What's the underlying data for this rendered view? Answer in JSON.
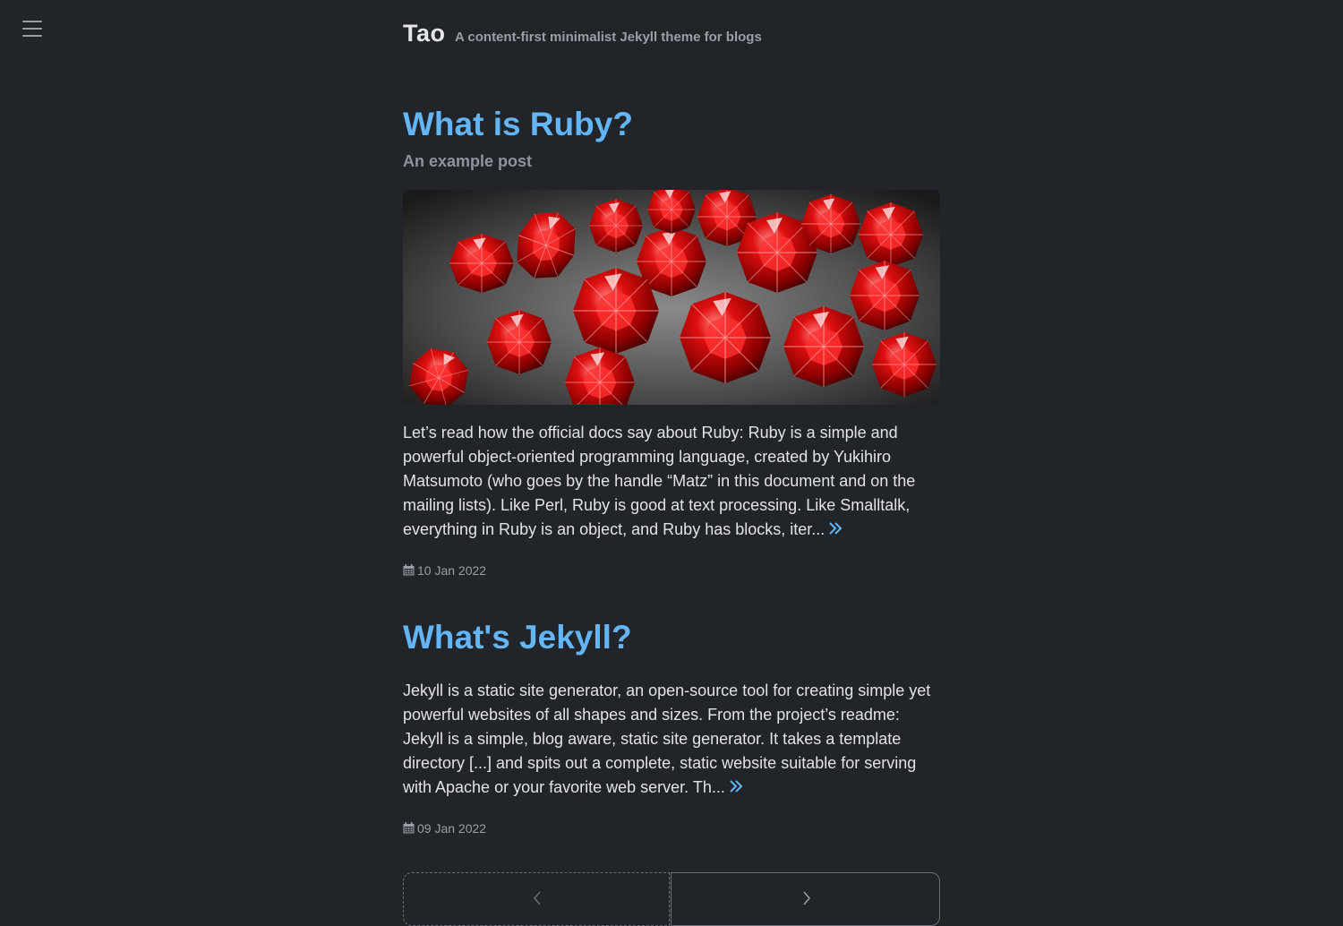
{
  "site": {
    "title": "Tao",
    "tagline": "A content-first minimalist Jekyll theme for blogs"
  },
  "icons": {
    "menu": "hamburger-menu-icon",
    "read_more": "double-chevron-right-icon",
    "date": "calendar-icon",
    "prev": "chevron-left-icon",
    "next": "chevron-right-icon"
  },
  "colors": {
    "background": "#212429",
    "accent": "#64b5f6",
    "text": "#e3e3e3",
    "muted": "#9aa0a6"
  },
  "posts": [
    {
      "title": "What is Ruby?",
      "subtitle": "An example post",
      "image_alt": "red rubies",
      "excerpt": "Let’s read how the official docs say about Ruby: Ruby is a simple and powerful object-oriented programming language, created by Yukihiro Matsumoto (who goes by the handle “Matz” in this document and on the mailing lists). Like Perl, Ruby is good at text processing. Like Smalltalk, everything in Ruby is an object, and Ruby has blocks, iter...",
      "date": "10 Jan 2022"
    },
    {
      "title": "What's Jekyll?",
      "excerpt": "Jekyll is a static site generator, an open-source tool for creating simple yet powerful websites of all shapes and sizes. From the project’s readme: Jekyll is a simple, blog aware, static site generator. It takes a template directory [...] and spits out a complete, static website suitable for serving with Apache or your favorite web server. Th...",
      "date": "09 Jan 2022"
    }
  ]
}
